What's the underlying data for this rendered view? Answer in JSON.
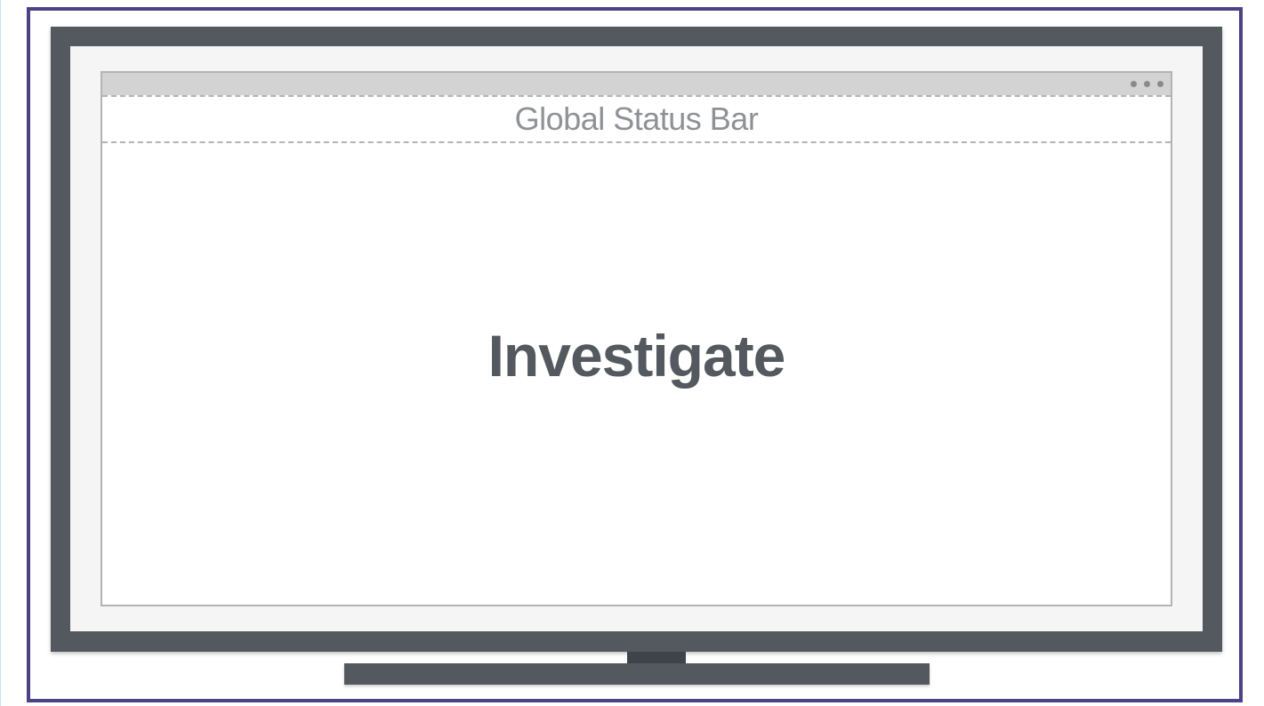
{
  "status_bar": {
    "label": "Global Status Bar"
  },
  "main": {
    "heading": "Investigate"
  },
  "window_controls": {
    "icon": "more-options-icon"
  },
  "colors": {
    "frame_border": "#4b4385",
    "monitor_body": "#54585f",
    "bezel_inner": "#f5f5f5",
    "titlebar": "#d3d3d3",
    "status_text": "#8e9196",
    "heading_text": "#54585f"
  }
}
